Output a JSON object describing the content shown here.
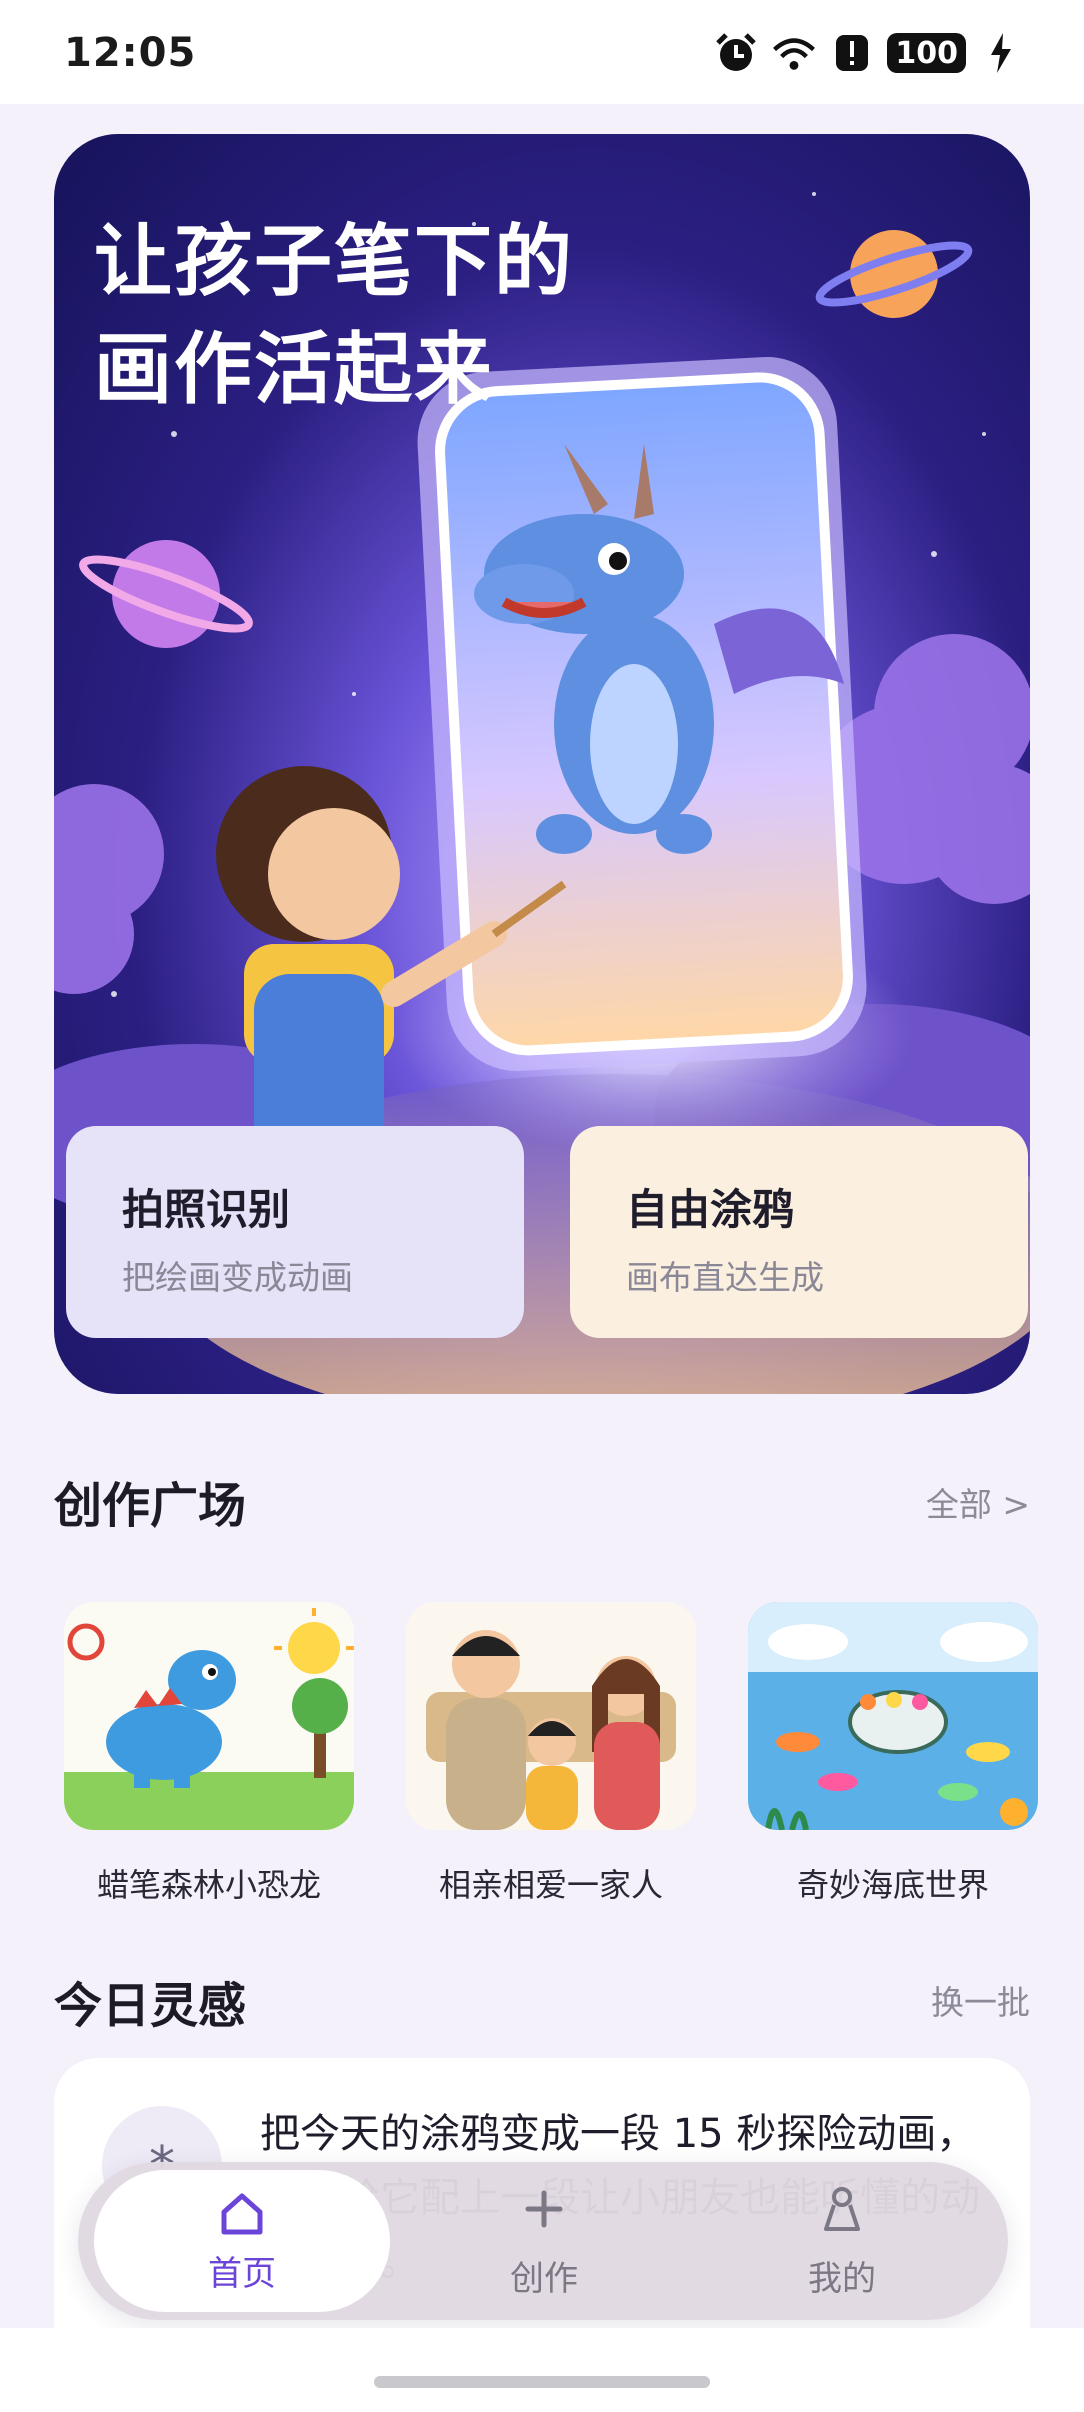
{
  "status_bar": {
    "time": "12:05",
    "battery": "100",
    "icons": [
      "alarm-icon",
      "wifi-icon",
      "alert-icon",
      "battery-icon",
      "charging-icon"
    ]
  },
  "hero": {
    "title_line1": "让孩子笔下的",
    "title_line2": "画作活起来",
    "cards": [
      {
        "title": "拍照识别",
        "subtitle": "把绘画变成动画"
      },
      {
        "title": "自由涂鸦",
        "subtitle": "画布直达生成"
      }
    ]
  },
  "gallery": {
    "title": "创作广场",
    "link": "全部 >",
    "items": [
      {
        "label": "蜡笔森林小恐龙"
      },
      {
        "label": "相亲相爱一家人"
      },
      {
        "label": "奇妙海底世界"
      }
    ]
  },
  "inspiration": {
    "title": "今日灵感",
    "link": "换一批",
    "icon": "*",
    "text": "把今天的涂鸦变成一段 15 秒探险动画，然后给它配上一段让小朋友也能听懂的动画脚本。"
  },
  "tabbar": {
    "tabs": [
      {
        "label": "首页",
        "active": true
      },
      {
        "label": "创作",
        "active": false
      },
      {
        "label": "我的",
        "active": false
      }
    ]
  },
  "colors": {
    "accent": "#6b45d8",
    "background": "#f4f1fb",
    "card_left": "#e6e2f8",
    "card_right": "#fbf0e0"
  }
}
